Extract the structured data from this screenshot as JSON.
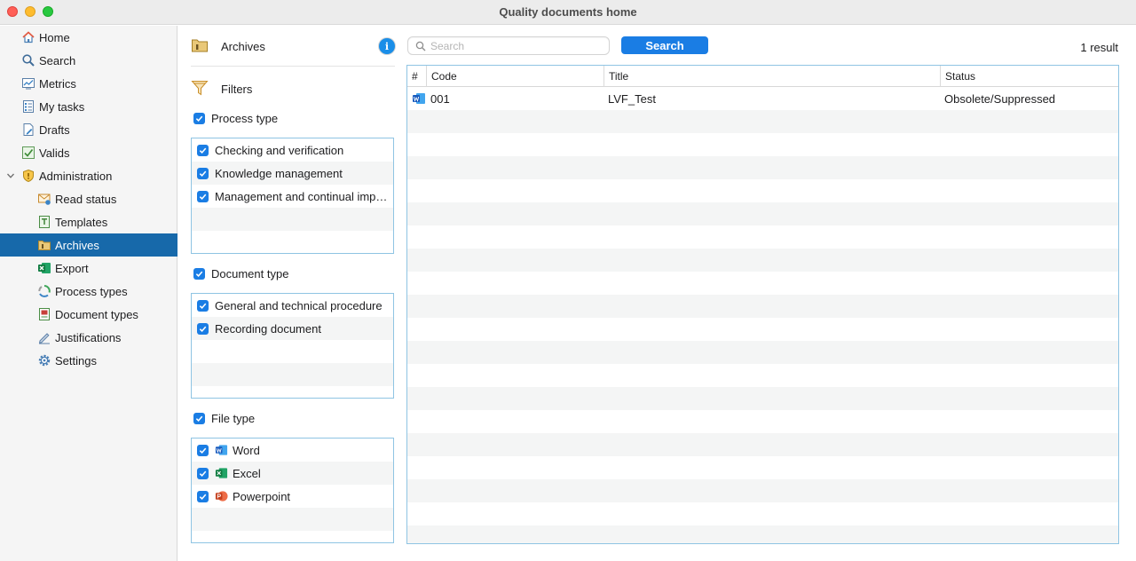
{
  "window": {
    "title": "Quality documents home"
  },
  "sidebar": {
    "items": [
      {
        "label": "Home",
        "icon": "home-icon"
      },
      {
        "label": "Search",
        "icon": "search-icon"
      },
      {
        "label": "Metrics",
        "icon": "metrics-icon"
      },
      {
        "label": "My tasks",
        "icon": "tasks-icon"
      },
      {
        "label": "Drafts",
        "icon": "drafts-icon"
      },
      {
        "label": "Valids",
        "icon": "valids-icon"
      },
      {
        "label": "Administration",
        "icon": "shield-icon"
      },
      {
        "label": "Read status",
        "icon": "read-status-icon"
      },
      {
        "label": "Templates",
        "icon": "templates-icon"
      },
      {
        "label": "Archives",
        "icon": "archive-folder-icon"
      },
      {
        "label": "Export",
        "icon": "excel-icon"
      },
      {
        "label": "Process types",
        "icon": "process-cycle-icon"
      },
      {
        "label": "Document types",
        "icon": "document-type-icon"
      },
      {
        "label": "Justifications",
        "icon": "pencil-icon"
      },
      {
        "label": "Settings",
        "icon": "gear-icon"
      }
    ],
    "selected": "Archives"
  },
  "filters_panel": {
    "header_label": "Archives",
    "info_label": "i",
    "filters_label": "Filters",
    "groups": [
      {
        "label": "Process type",
        "checked": true,
        "options": [
          {
            "label": "Checking and verification",
            "checked": true
          },
          {
            "label": "Knowledge management",
            "checked": true
          },
          {
            "label": "Management and continual imp…",
            "checked": true
          }
        ]
      },
      {
        "label": "Document type",
        "checked": true,
        "options": [
          {
            "label": "General and technical procedure",
            "checked": true
          },
          {
            "label": "Recording document",
            "checked": true
          }
        ]
      },
      {
        "label": "File type",
        "checked": true,
        "options": [
          {
            "label": "Word",
            "checked": true,
            "icon": "word-icon"
          },
          {
            "label": "Excel",
            "checked": true,
            "icon": "excel-icon"
          },
          {
            "label": "Powerpoint",
            "checked": true,
            "icon": "powerpoint-icon"
          }
        ]
      }
    ]
  },
  "search": {
    "placeholder": "Search",
    "value": "",
    "button_label": "Search",
    "result_count": "1 result"
  },
  "results_table": {
    "columns": [
      "#",
      "Code",
      "Title",
      "Status"
    ],
    "rows": [
      {
        "icon": "word-icon",
        "code": "001",
        "title": "LVF_Test",
        "status": "Obsolete/Suppressed"
      }
    ]
  },
  "colors": {
    "accent": "#1a7de4",
    "selection": "#1769aa",
    "box_border": "#8fc4e3"
  }
}
